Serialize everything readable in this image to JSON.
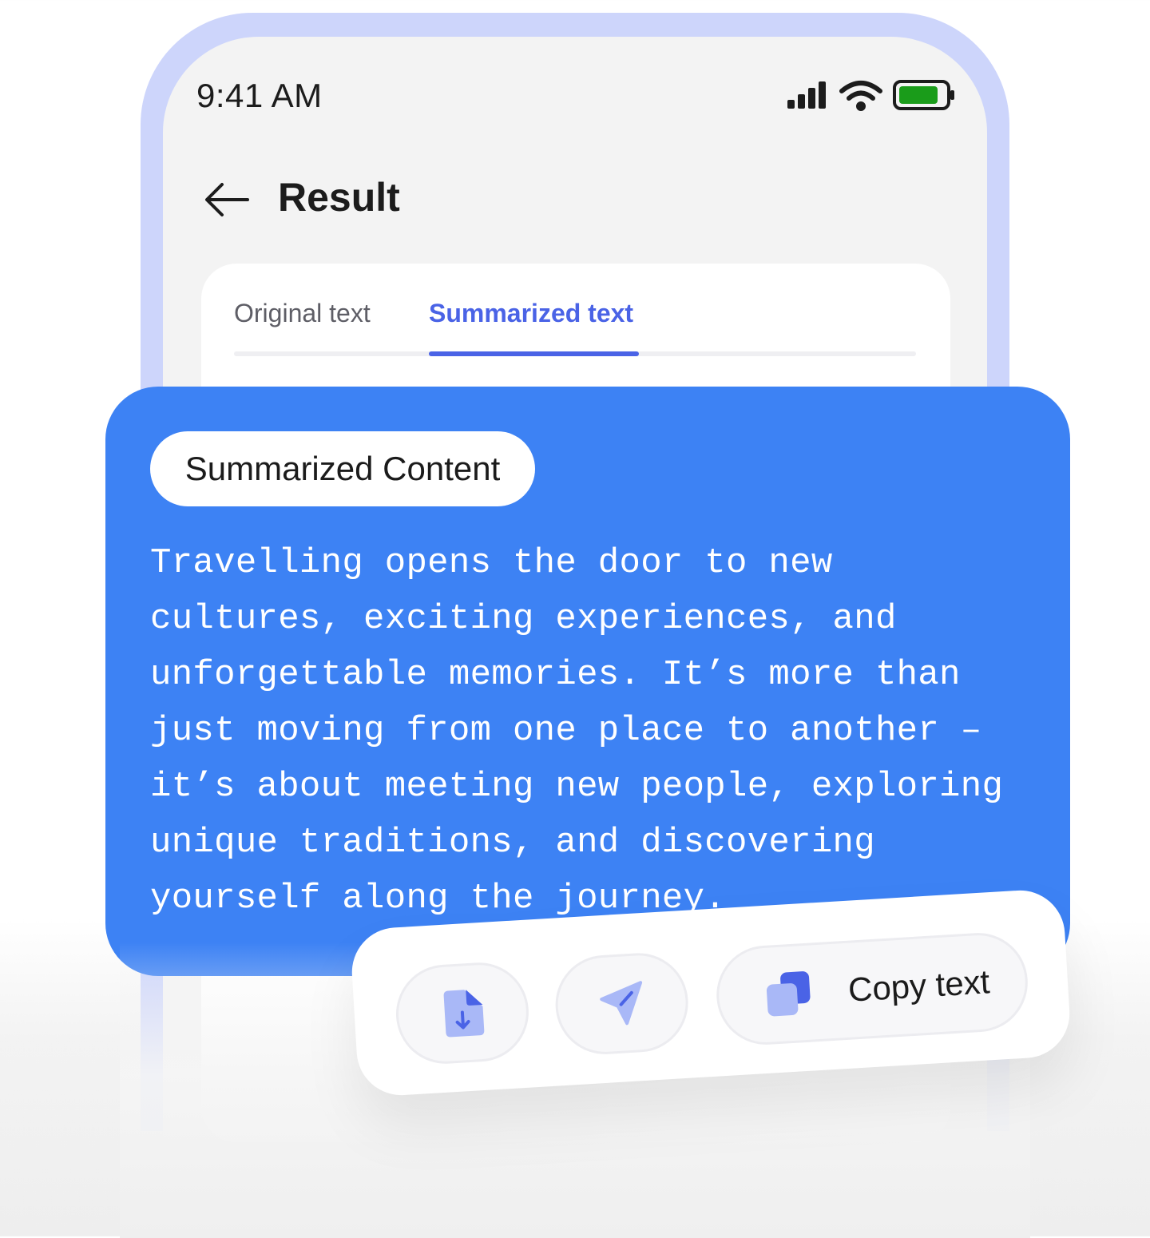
{
  "status_bar": {
    "time": "9:41 AM",
    "icons": [
      "cellular-signal-icon",
      "wifi-icon",
      "battery-icon"
    ],
    "battery_color": "#1a9c1a"
  },
  "header": {
    "back_icon": "arrow-left-icon",
    "title": "Result"
  },
  "tabs": [
    {
      "label": "Original text",
      "active": false
    },
    {
      "label": "Summarized text",
      "active": true
    }
  ],
  "summary": {
    "badge": "Summarized Content",
    "text": "Travelling opens the door to new\ncultures, exciting experiences, and\nunforgettable memories. It’s more than\njust moving from one place to another –\nit’s about meeting new people, exploring\nunique traditions, and discovering\nyourself along the journey."
  },
  "actions": {
    "download_icon": "download-file-icon",
    "send_icon": "send-icon",
    "copy_icon": "copy-icon",
    "copy_label": "Copy text"
  },
  "colors": {
    "accent": "#4a63e6",
    "card_blue": "#3d82f4",
    "frame": "#cdd5fb",
    "icon_light": "#a9b8f7"
  }
}
